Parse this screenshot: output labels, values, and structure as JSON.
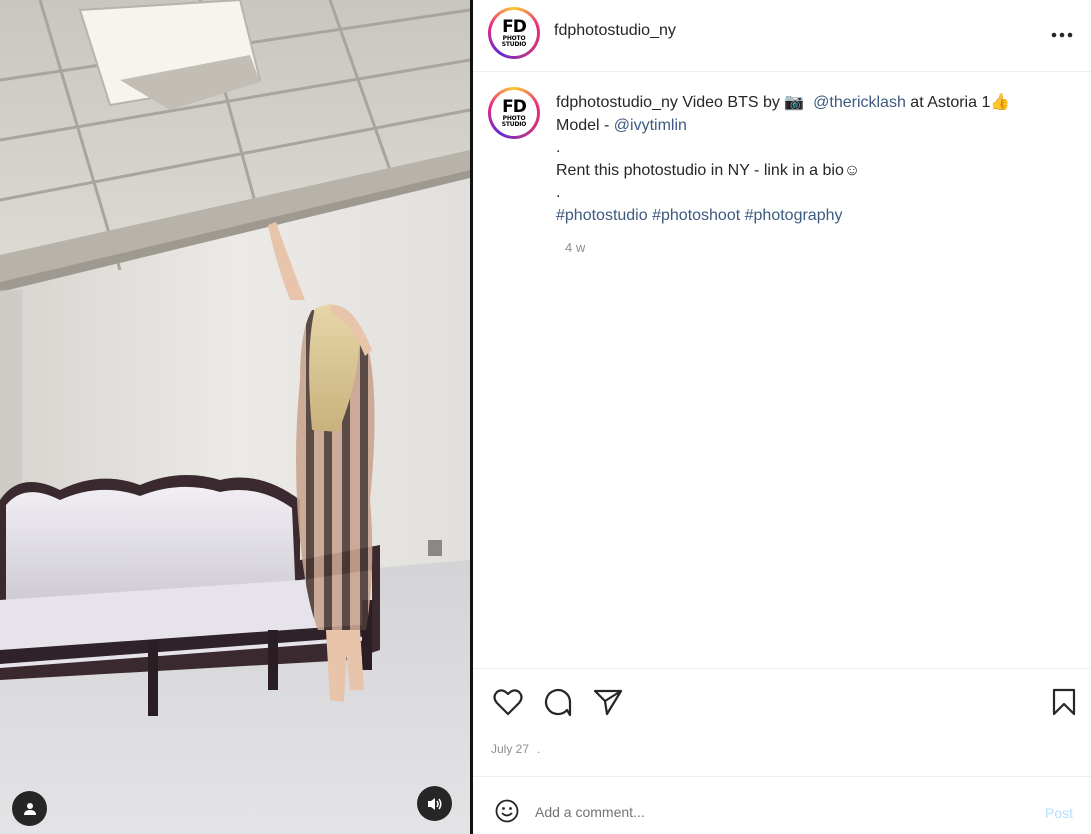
{
  "account": {
    "username": "fdphotostudio_ny",
    "avatar_text_top": "FD",
    "avatar_text_mid": "PHOTO",
    "avatar_text_bottom": "STUDIO"
  },
  "caption": {
    "username": "fdphotostudio_ny",
    "intro": " Video BTS by ",
    "camera_emoji": "📷",
    "mention_1": "@thericklash",
    "after_mention_1": " at Astoria 1",
    "thumbs_emoji": "👍",
    "model_prefix": "Model - ",
    "mention_2": "@ivytimlin",
    "dot_1": ".",
    "line_rent": "Rent this photostudio in NY - link in a bio",
    "smile_emoji": "☺",
    "dot_2": ".",
    "hashtag_1": "#photostudio",
    "hashtag_2": "#photoshoot",
    "hashtag_3": "#photography",
    "age": "4 w"
  },
  "icons": {
    "more": "more-options-icon",
    "like": "heart-icon",
    "comment": "comment-icon",
    "share": "share-icon",
    "save": "bookmark-icon",
    "emoji": "emoji-icon",
    "tag": "user-tag-icon",
    "mute": "speaker-icon"
  },
  "post": {
    "date": "July 27",
    "date_suffix": "."
  },
  "comment": {
    "placeholder": "Add a comment...",
    "post_label": "Post"
  },
  "colors": {
    "link": "#3d5a80",
    "post_disabled": "#b2dffc"
  }
}
